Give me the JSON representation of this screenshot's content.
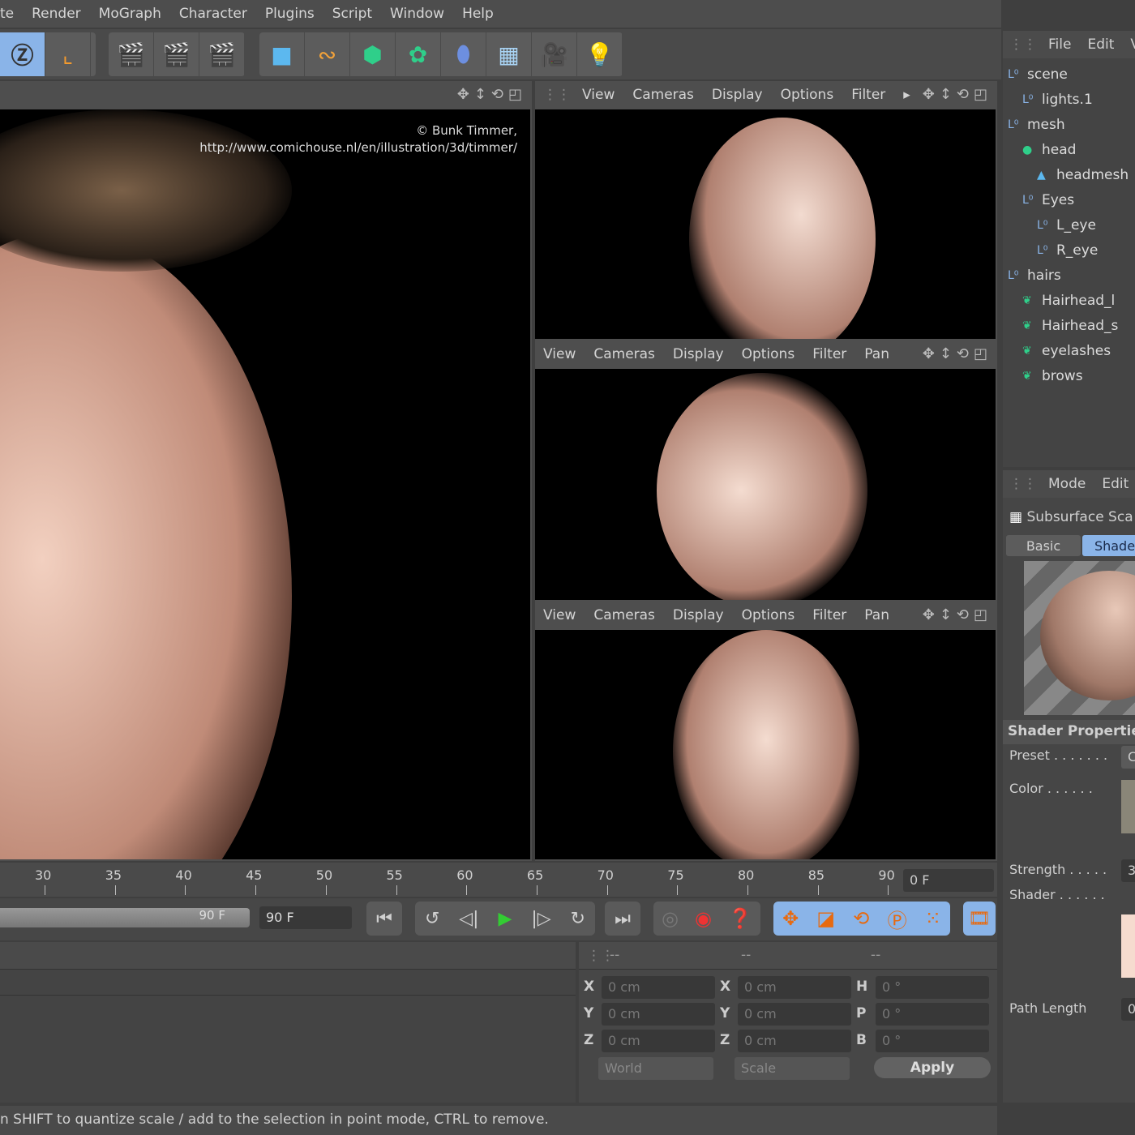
{
  "menu": [
    "te",
    "Render",
    "MoGraph",
    "Character",
    "Plugins",
    "Script",
    "Window",
    "Help"
  ],
  "main_view": {
    "credit": "© Bunk Timmer,",
    "url": "http://www.comichouse.nl/en/illustration/3d/timmer/"
  },
  "viewport_menu": [
    "View",
    "Cameras",
    "Display",
    "Options",
    "Filter",
    "Pan"
  ],
  "object_manager": {
    "menu": [
      "File",
      "Edit",
      "Vi"
    ],
    "items": [
      {
        "label": "scene",
        "indent": 0,
        "type": "null"
      },
      {
        "label": "lights.1",
        "indent": 1,
        "type": "null"
      },
      {
        "label": "mesh",
        "indent": 0,
        "type": "null"
      },
      {
        "label": "head",
        "indent": 1,
        "type": "sphere"
      },
      {
        "label": "headmesh",
        "indent": 2,
        "type": "mesh"
      },
      {
        "label": "Eyes",
        "indent": 1,
        "type": "null"
      },
      {
        "label": "L_eye",
        "indent": 2,
        "type": "null"
      },
      {
        "label": "R_eye",
        "indent": 2,
        "type": "null"
      },
      {
        "label": "hairs",
        "indent": 0,
        "type": "null"
      },
      {
        "label": "Hairhead_l",
        "indent": 1,
        "type": "hair"
      },
      {
        "label": "Hairhead_s",
        "indent": 1,
        "type": "hair"
      },
      {
        "label": "eyelashes",
        "indent": 1,
        "type": "hair"
      },
      {
        "label": "brows",
        "indent": 1,
        "type": "hair"
      }
    ]
  },
  "attribute_manager": {
    "menu": [
      "Mode",
      "Edit"
    ],
    "title": "Subsurface Sca",
    "tabs": [
      "Basic",
      "Shade"
    ],
    "active_tab": "Shade",
    "section": "Shader Properties",
    "preset_label": "Preset . . . . . . .",
    "preset_value": "C",
    "color_label": "Color . . . . . .",
    "color_swatch": "#8a8678",
    "strength_label": "Strength . . . . .",
    "strength_value": "3",
    "shader_label": "Shader . . . . . .",
    "shader_swatch": "#f6dccf",
    "path_length_label": "Path Length",
    "path_length_value": "0"
  },
  "timeline": {
    "ticks": [
      "30",
      "35",
      "40",
      "45",
      "50",
      "55",
      "60",
      "65",
      "70",
      "75",
      "80",
      "85",
      "90"
    ],
    "current_frame": "0 F",
    "end_frame": "90 F",
    "slider_end": "90 F"
  },
  "coordinates": {
    "headers": [
      "--",
      "--",
      "--"
    ],
    "col1_labels": [
      "X",
      "Y",
      "Z"
    ],
    "col1_values": [
      "0 cm",
      "0 cm",
      "0 cm"
    ],
    "col2_labels": [
      "X",
      "Y",
      "Z"
    ],
    "col2_values": [
      "0 cm",
      "0 cm",
      "0 cm"
    ],
    "col3_labels": [
      "H",
      "P",
      "B"
    ],
    "col3_values": [
      "0 °",
      "0 °",
      "0 °"
    ],
    "mode": "World",
    "type": "Scale",
    "apply": "Apply"
  },
  "status": "n SHIFT to quantize scale / add to the selection in point mode, CTRL to remove.",
  "colors": {
    "accent": "#8ab4e8",
    "panel": "#4b4b4b"
  }
}
